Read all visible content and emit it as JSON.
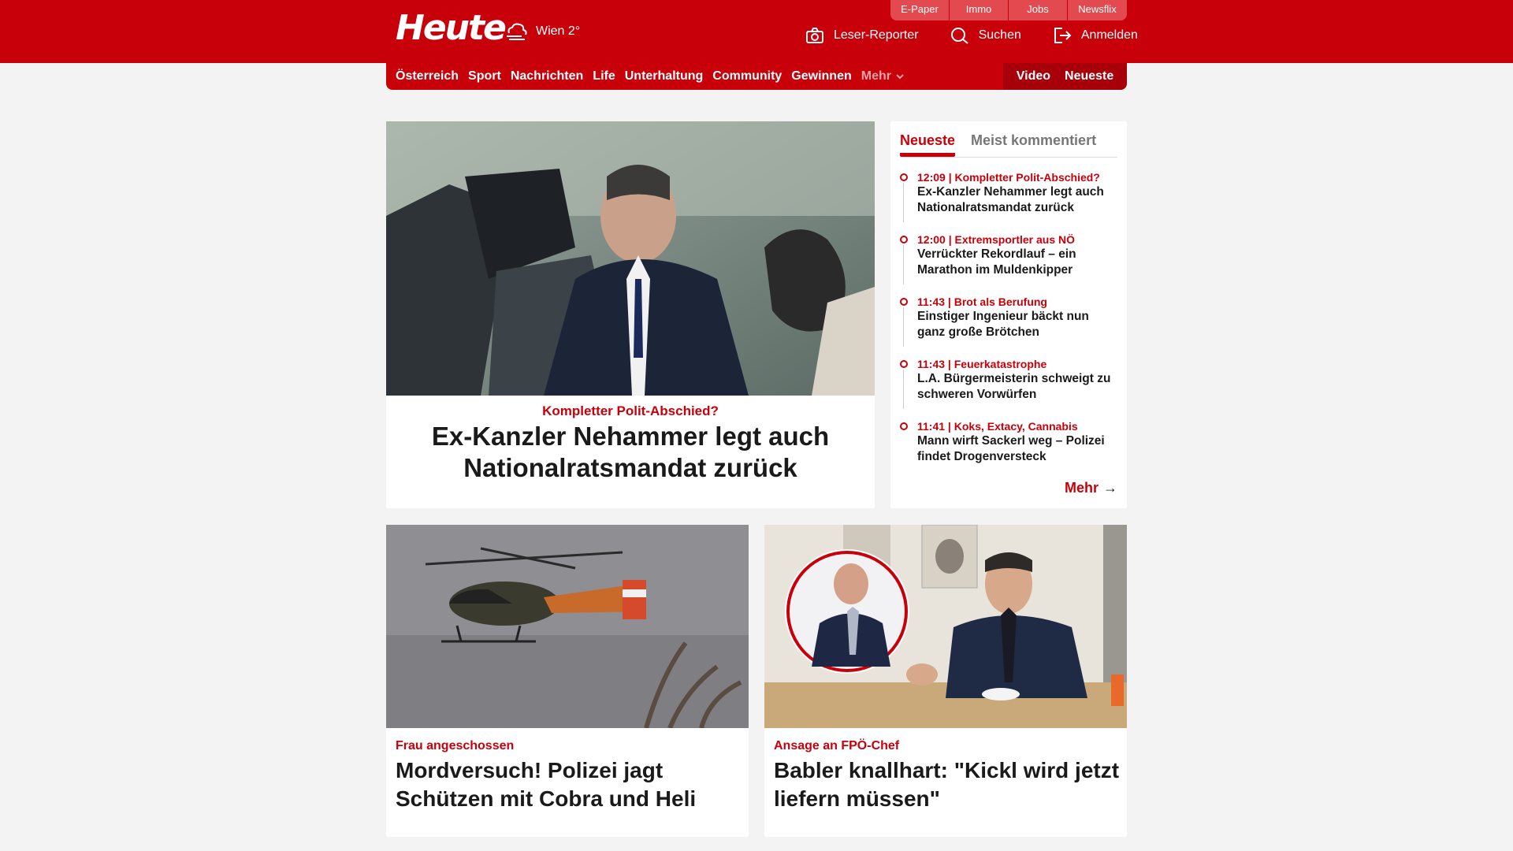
{
  "brand": {
    "logo": "Heute",
    "weather": "Wien 2°"
  },
  "toplinks": [
    "E-Paper",
    "Immo",
    "Jobs",
    "Newsflix"
  ],
  "actions": {
    "reporter": "Leser-Reporter",
    "search": "Suchen",
    "login": "Anmelden"
  },
  "nav": {
    "items": [
      "Österreich",
      "Sport",
      "Nachrichten",
      "Life",
      "Unterhaltung",
      "Community",
      "Gewinnen"
    ],
    "more": "Mehr",
    "right": [
      "Video",
      "Neueste"
    ]
  },
  "hero": {
    "kicker": "Kompletter Polit-Abschied?",
    "headline": "Ex-Kanzler Nehammer legt auch Nationalratsmandat zurück"
  },
  "sidebar": {
    "tabs": [
      "Neueste",
      "Meist kommentiert"
    ],
    "items": [
      {
        "time": "12:09",
        "topic": "Kompletter Polit-Abschied?",
        "title": "Ex-Kanzler Nehammer legt auch Nationalratsmandat zurück"
      },
      {
        "time": "12:00",
        "topic": "Extremsportler aus NÖ",
        "title": "Verrückter Rekordlauf – ein Marathon im Muldenkipper"
      },
      {
        "time": "11:43",
        "topic": "Brot als Berufung",
        "title": "Einstiger Ingenieur bäckt nun ganz große Brötchen"
      },
      {
        "time": "11:43",
        "topic": "Feuerkatastrophe",
        "title": "L.A. Bürgermeisterin schweigt zu schweren Vorwürfen"
      },
      {
        "time": "11:41",
        "topic": "Koks, Extacy, Cannabis",
        "title": "Mann wirft Sackerl weg – Polizei findet Drogenversteck"
      }
    ],
    "more": "Mehr"
  },
  "cards": [
    {
      "kicker": "Frau angeschossen",
      "headline": "Mordversuch! Polizei jagt Schützen mit Cobra und Heli"
    },
    {
      "kicker": "Ansage an FPÖ-Chef",
      "headline": "Babler knallhart: \"Kickl wird jetzt liefern müssen\""
    }
  ],
  "colors": {
    "brand_red": "#c8000a",
    "dark_red": "#a8000a",
    "background": "#f3f3f3"
  }
}
